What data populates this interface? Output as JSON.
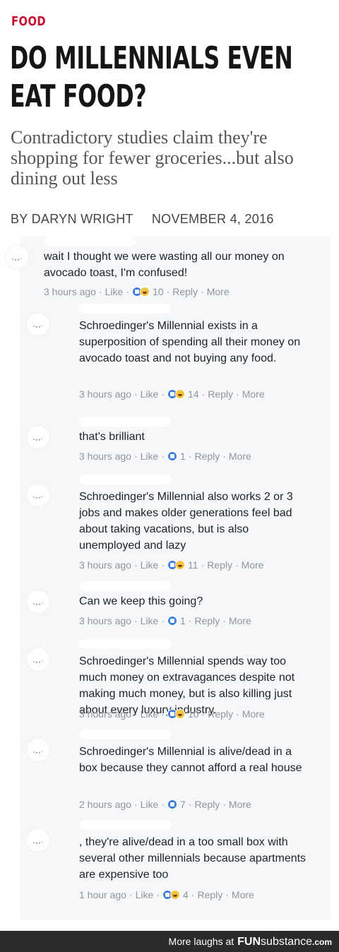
{
  "article": {
    "section": "FOOD",
    "headline_line1": "DO MILLENNIALS EVEN",
    "headline_line2": "EAT FOOD?",
    "dek": "Contradictory studies claim they're shopping for fewer groceries...but also dining out less",
    "author": "BY DARYN WRIGHT",
    "date": "NOVEMBER 4, 2016"
  },
  "ui": {
    "like": "Like",
    "reply": "Reply",
    "more": "More",
    "sep": "·"
  },
  "comments": [
    {
      "text": "wait I thought we were wasting all our money on avocado toast, I'm confused!",
      "time": "3 hours ago",
      "reactions": [
        "like",
        "haha"
      ],
      "count": "10"
    },
    {
      "text": "Schroedinger's Millennial exists in a superposition of spending all their money on avocado toast and not buying any food.",
      "time": "3 hours ago",
      "reactions": [
        "like",
        "haha"
      ],
      "count": "14"
    },
    {
      "text": "that's brilliant",
      "time": "3 hours ago",
      "reactions": [
        "like"
      ],
      "count": "1"
    },
    {
      "text": "Schroedinger's Millennial also works 2 or 3 jobs and makes older generations feel bad about taking vacations, but is also unemployed and lazy",
      "time": "3 hours ago",
      "reactions": [
        "like",
        "haha"
      ],
      "count": "11"
    },
    {
      "text": "Can we keep this going?",
      "time": "3 hours ago",
      "reactions": [
        "like"
      ],
      "count": "1"
    },
    {
      "text": "Schroedinger's Millennial spends way too much money on extravagances despite not making much money, but is also killing just about every luxury industry.",
      "time": "3 hours ago",
      "reactions": [
        "like",
        "haha"
      ],
      "count": "10"
    },
    {
      "text": "Schroedinger's Millennial is alive/dead in a box because they cannot afford a real house",
      "time": "2 hours ago",
      "reactions": [
        "like"
      ],
      "count": "7"
    },
    {
      "text": ", they're alive/dead in a too small box with several other millennials because apartments are expensive too",
      "time": "1 hour ago",
      "reactions": [
        "like",
        "haha"
      ],
      "count": "4"
    }
  ],
  "footer": {
    "prefix": "More laughs at",
    "brand_bold": "FUN",
    "brand_rest": "substance",
    "tld": ".com"
  }
}
